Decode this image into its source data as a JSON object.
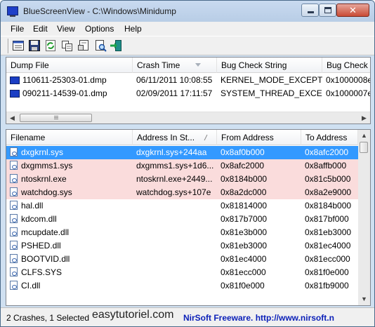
{
  "window": {
    "title": "BlueScreenView  -  C:\\Windows\\Minidump"
  },
  "menu": [
    "File",
    "Edit",
    "View",
    "Options",
    "Help"
  ],
  "toolbar": {
    "buttons": [
      "properties-icon",
      "save-icon",
      "refresh-icon",
      "copy-icon",
      "html-report-icon",
      "find-icon",
      "exit-icon"
    ]
  },
  "dumps": {
    "columns": [
      "Dump File",
      "Crash Time",
      "Bug Check String",
      "Bug Check"
    ],
    "rows": [
      {
        "file": "110611-25303-01.dmp",
        "time": "06/11/2011 10:08:55",
        "bugstring": "KERNEL_MODE_EXCEPTI...",
        "bugcheck": "0x1000008e"
      },
      {
        "file": "090211-14539-01.dmp",
        "time": "02/09/2011 17:11:57",
        "bugstring": "SYSTEM_THREAD_EXCE...",
        "bugcheck": "0x1000007e"
      }
    ]
  },
  "drivers": {
    "columns": [
      "Filename",
      "Address In St...",
      "From Address",
      "To Address"
    ],
    "rows": [
      {
        "file": "dxgkrnl.sys",
        "addr_in_stack": "dxgkrnl.sys+244aa",
        "from": "0x8af0b000",
        "to": "0x8afc2000",
        "state": "selected"
      },
      {
        "file": "dxgmms1.sys",
        "addr_in_stack": "dxgmms1.sys+1d6...",
        "from": "0x8afc2000",
        "to": "0x8affb000",
        "state": "highlight"
      },
      {
        "file": "ntoskrnl.exe",
        "addr_in_stack": "ntoskrnl.exe+2449...",
        "from": "0x8184b000",
        "to": "0x81c5b000",
        "state": "highlight"
      },
      {
        "file": "watchdog.sys",
        "addr_in_stack": "watchdog.sys+107e",
        "from": "0x8a2dc000",
        "to": "0x8a2e9000",
        "state": "highlight"
      },
      {
        "file": "hal.dll",
        "addr_in_stack": "",
        "from": "0x81814000",
        "to": "0x8184b000",
        "state": "normal"
      },
      {
        "file": "kdcom.dll",
        "addr_in_stack": "",
        "from": "0x817b7000",
        "to": "0x817bf000",
        "state": "normal"
      },
      {
        "file": "mcupdate.dll",
        "addr_in_stack": "",
        "from": "0x81e3b000",
        "to": "0x81eb3000",
        "state": "normal"
      },
      {
        "file": "PSHED.dll",
        "addr_in_stack": "",
        "from": "0x81eb3000",
        "to": "0x81ec4000",
        "state": "normal"
      },
      {
        "file": "BOOTVID.dll",
        "addr_in_stack": "",
        "from": "0x81ec4000",
        "to": "0x81ecc000",
        "state": "normal"
      },
      {
        "file": "CLFS.SYS",
        "addr_in_stack": "",
        "from": "0x81ecc000",
        "to": "0x81f0e000",
        "state": "normal"
      },
      {
        "file": "CI.dll",
        "addr_in_stack": "",
        "from": "0x81f0e000",
        "to": "0x81fb9000",
        "state": "normal"
      }
    ]
  },
  "status": {
    "summary": "2 Crashes, 1 Selected",
    "brand": "NirSoft Freeware.  http://www.nirsoft.n"
  },
  "watermark": "easytutoriel.com",
  "colors": {
    "selection": "#3399ff",
    "highlight": "#fadcdc",
    "brand_text": "#0a1fb8"
  }
}
